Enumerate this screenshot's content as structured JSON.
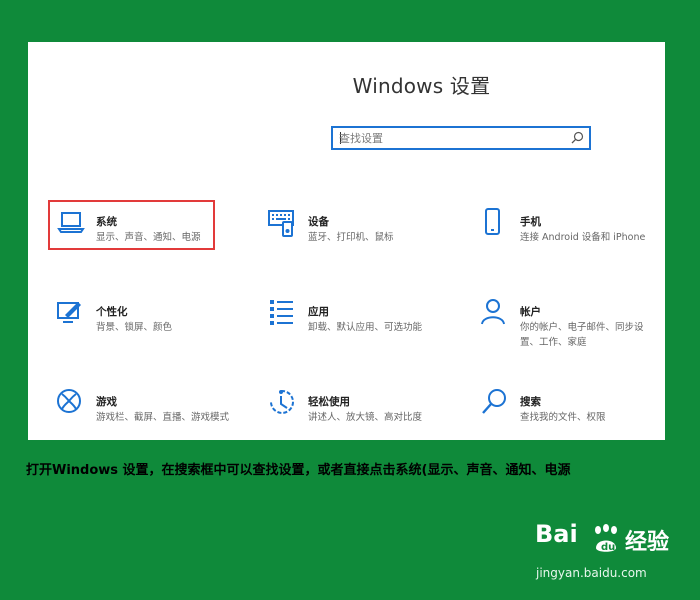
{
  "settings_window": {
    "title": "Windows 设置",
    "search": {
      "placeholder": "查找设置"
    }
  },
  "tiles": [
    {
      "name": "系统",
      "desc": "显示、声音、通知、电源",
      "icon": "laptop-icon"
    },
    {
      "name": "设备",
      "desc": "蓝牙、打印机、鼠标",
      "icon": "keyboard-icon"
    },
    {
      "name": "手机",
      "desc": "连接 Android 设备和 iPhone",
      "icon": "phone-icon"
    },
    {
      "name": "个性化",
      "desc": "背景、锁屏、颜色",
      "icon": "brush-icon"
    },
    {
      "name": "应用",
      "desc": "卸载、默认应用、可选功能",
      "icon": "apps-list-icon"
    },
    {
      "name": "帐户",
      "desc": "你的帐户、电子邮件、同步设置、工作、家庭",
      "icon": "person-icon"
    },
    {
      "name": "游戏",
      "desc": "游戏栏、截屏、直播、游戏模式",
      "icon": "xbox-icon"
    },
    {
      "name": "轻松使用",
      "desc": "讲述人、放大镜、高对比度",
      "icon": "ease-of-access-icon"
    },
    {
      "name": "搜索",
      "desc": "查找我的文件、权限",
      "icon": "magnifier-icon"
    }
  ],
  "caption": "打开Windows 设置，在搜索框中可以查找设置，或者直接点击系统(显示、声音、通知、电源",
  "watermark": {
    "brand": "Bai",
    "product": "经验",
    "url": "jingyan.baidu.com"
  },
  "colors": {
    "background": "#0f8a3a",
    "accent": "#1c73d3",
    "highlight": "#e23a3a"
  }
}
